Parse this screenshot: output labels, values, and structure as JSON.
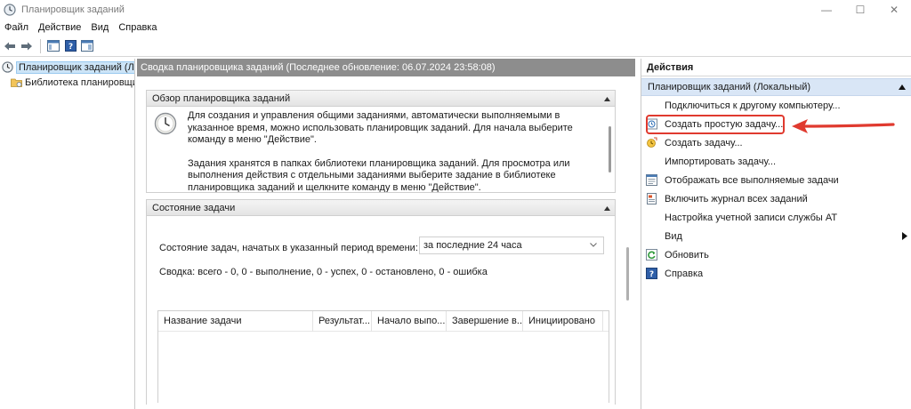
{
  "window": {
    "title": "Планировщик заданий",
    "minimize": "—",
    "maximize": "☐",
    "close": "✕"
  },
  "menu": [
    "Файл",
    "Действие",
    "Вид",
    "Справка"
  ],
  "tree": {
    "root": "Планировщик заданий (Локальный)",
    "child": "Библиотека планировщика заданий"
  },
  "center": {
    "header": "Сводка планировщика заданий (Последнее обновление: 06.07.2024 23:58:08)",
    "overview": {
      "title": "Обзор планировщика заданий",
      "paragraph1": "Для создания и управления общими заданиями, автоматически выполняемыми в указанное время, можно использовать планировщик заданий. Для начала выберите команду в меню \"Действие\".",
      "paragraph2": "Задания хранятся в папках библиотеки планировщика заданий. Для просмотра или выполнения действия с отдельными заданиями выберите задание в библиотеке планировщика заданий и щелкните команду в меню \"Действие\"."
    },
    "status": {
      "title": "Состояние задачи",
      "period_label": "Состояние задач, начатых в указанный период времени:",
      "period_value": "за последние 24 часа",
      "summary": "Сводка: всего - 0, 0 - выполнение, 0 - успех, 0 - остановлено, 0 - ошибка",
      "columns": [
        "Название задачи",
        "Результат...",
        "Начало выпо...",
        "Завершение в...",
        "Инициировано"
      ]
    }
  },
  "actions": {
    "title": "Действия",
    "group": "Планировщик заданий (Локальный)",
    "items": [
      {
        "label": "Подключиться к другому компьютеру...",
        "icon": "none"
      },
      {
        "label": "Создать простую задачу...",
        "icon": "create-basic-task-icon"
      },
      {
        "label": "Создать задачу...",
        "icon": "create-task-icon"
      },
      {
        "label": "Импортировать задачу...",
        "icon": "none"
      },
      {
        "label": "Отображать все выполняемые задачи",
        "icon": "running-tasks-icon"
      },
      {
        "label": "Включить журнал всех заданий",
        "icon": "history-log-icon"
      },
      {
        "label": "Настройка учетной записи службы AT",
        "icon": "none"
      },
      {
        "label": "Вид",
        "icon": "none"
      },
      {
        "label": "Обновить",
        "icon": "refresh-icon"
      },
      {
        "label": "Справка",
        "icon": "help-icon"
      }
    ]
  },
  "colors": {
    "header_gray": "#8d8d8d",
    "actions_group_bg": "#d9e6f6",
    "highlight_red": "#e03a2f",
    "selection_blue": "#cce4f7"
  }
}
